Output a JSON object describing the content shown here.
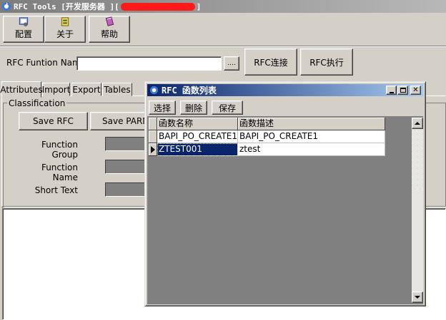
{
  "window": {
    "title": "RFC Tools [开发服务器 ][",
    "title_end": "]"
  },
  "toolbar": {
    "config_label": "配置",
    "about_label": "关于",
    "help_label": "帮助"
  },
  "function_bar": {
    "label": "RFC Funtion Name:",
    "value": "",
    "browse_label": "....",
    "connect_label": "RFC连接",
    "execute_label": "RFC执行"
  },
  "tabs": [
    {
      "label": "Attributes",
      "active": true
    },
    {
      "label": "Import"
    },
    {
      "label": "Export"
    },
    {
      "label": "Tables"
    }
  ],
  "classification": {
    "group_label": "Classification",
    "save_rfc_label": "Save RFC",
    "save_parm_label": "Save PARM",
    "function_group_label": "Function Group",
    "function_name_label": "Function Name",
    "short_text_label": "Short Text"
  },
  "dialog": {
    "title": "RFC 函数列表",
    "select_label": "选择",
    "delete_label": "删除",
    "save_label": "保存",
    "columns": [
      "函数名称",
      "函数描述"
    ],
    "rows": [
      {
        "name": "BAPI_PO_CREATE1",
        "desc": "BAPI_PO_CREATE1",
        "current": false
      },
      {
        "name": "ZTEST001",
        "desc": "ztest",
        "current": true
      }
    ]
  },
  "colors": {
    "dialog_title_start": "#0a246a",
    "dialog_title_end": "#a6caf0",
    "selection": "#0a246a",
    "redaction": "#ff1a1a"
  }
}
